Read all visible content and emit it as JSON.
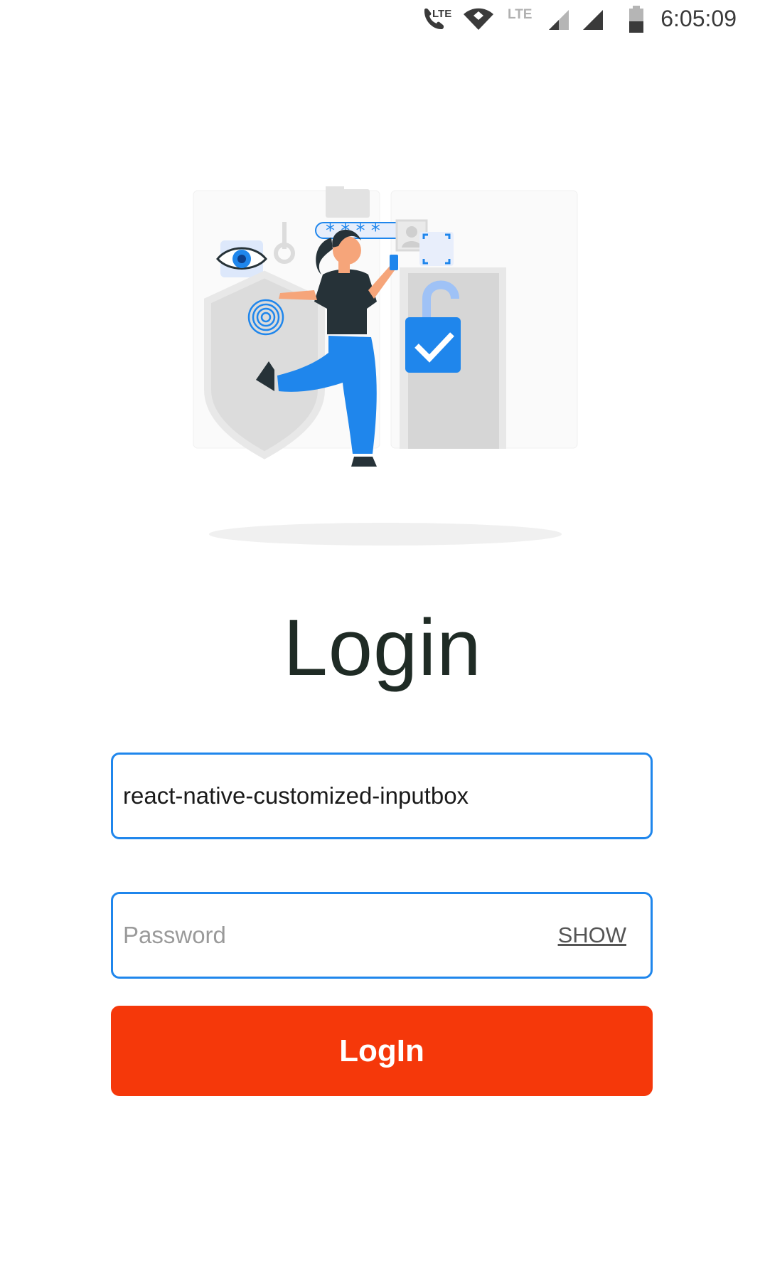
{
  "status_bar": {
    "call_lte_label": "LTE",
    "sim2_lte_label": "LTE",
    "time": "6:05:09",
    "icons": [
      "phone-lte-icon",
      "wifi-icon",
      "signal-icon",
      "signal-icon",
      "battery-icon"
    ]
  },
  "hero": {
    "illustration": "login-security-illustration",
    "password_mask": "* * * *"
  },
  "login": {
    "title": "Login",
    "username": {
      "value": "react-native-customized-inputbox",
      "placeholder": ""
    },
    "password": {
      "value": "",
      "placeholder": "Password",
      "toggle_label": "SHOW"
    },
    "submit_label": "LogIn"
  },
  "colors": {
    "accent_blue": "#1f86ec",
    "button_red": "#f5380a",
    "title_text": "#1f2b25"
  }
}
